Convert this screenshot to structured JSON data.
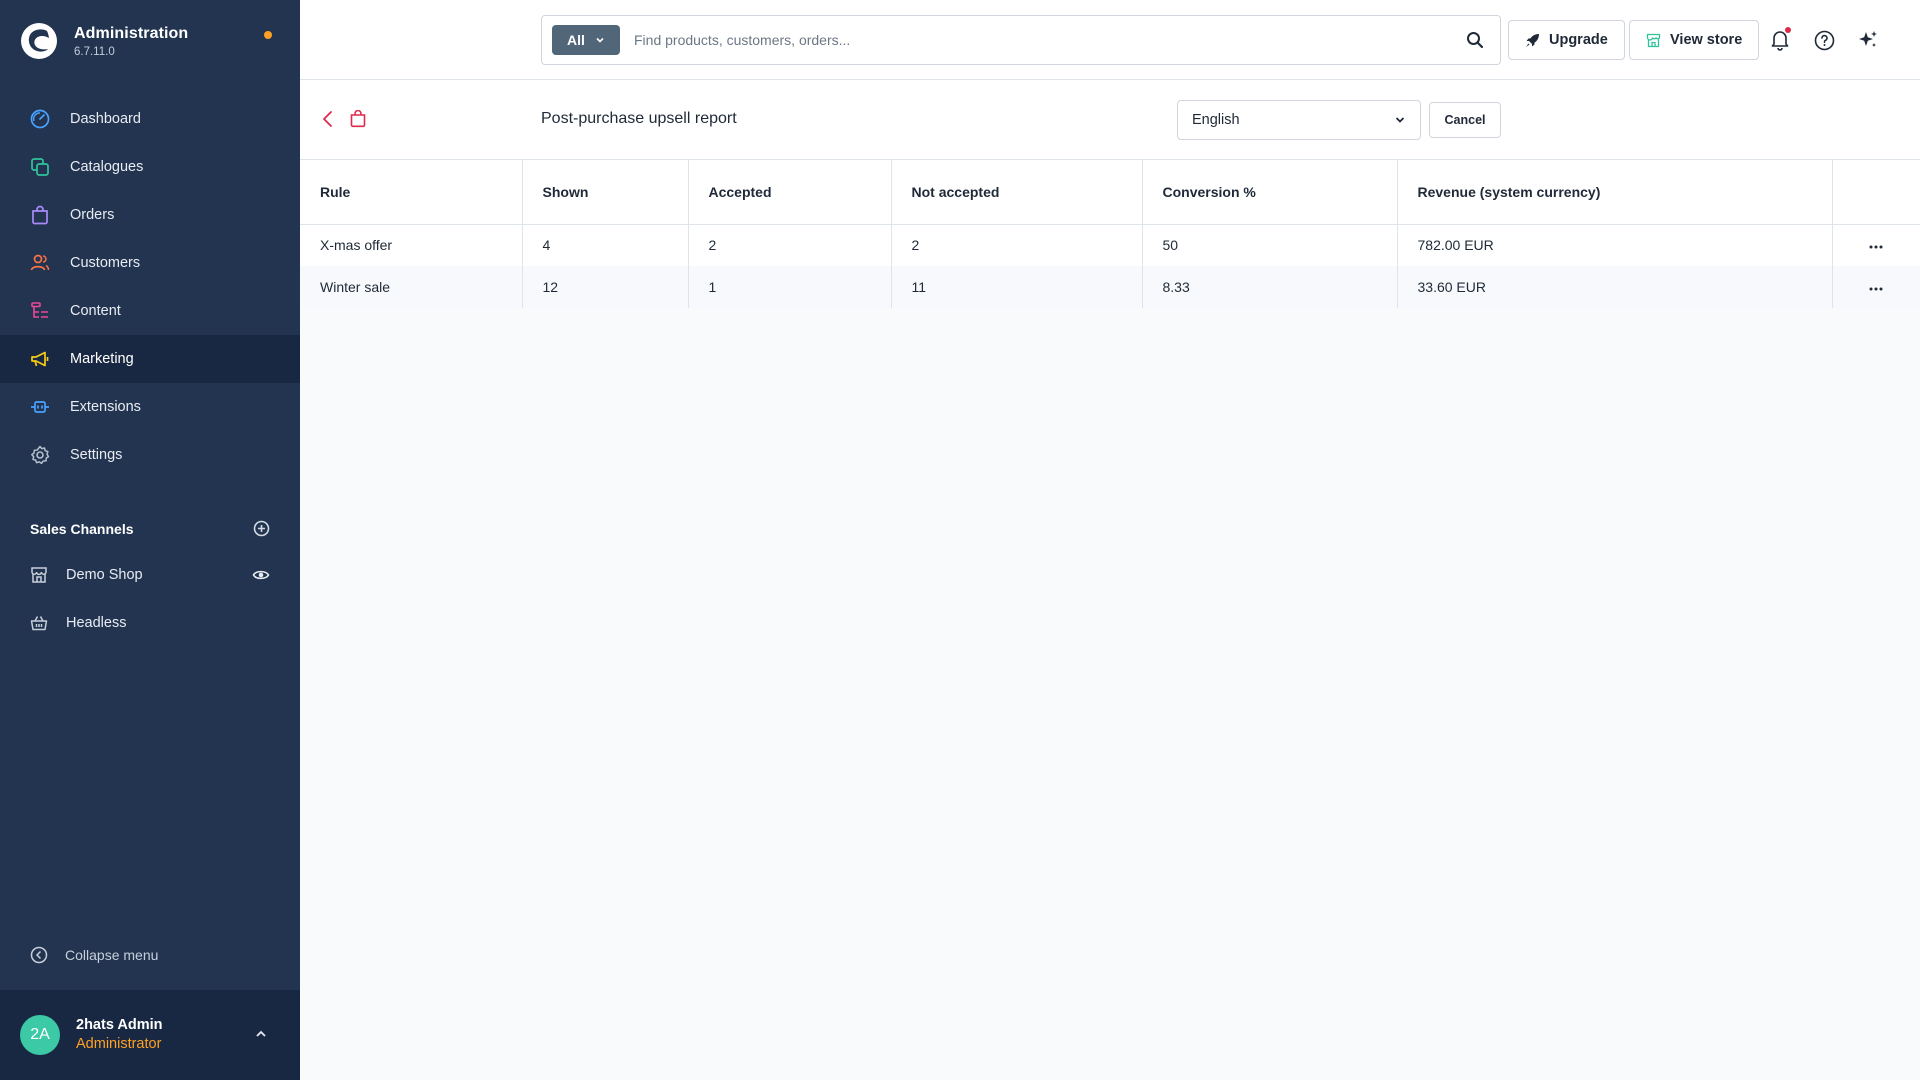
{
  "app": {
    "title": "Administration",
    "version": "6.7.11.0"
  },
  "sidebar": {
    "items": [
      {
        "label": "Dashboard",
        "icon": "dashboard-icon"
      },
      {
        "label": "Catalogues",
        "icon": "catalogues-icon"
      },
      {
        "label": "Orders",
        "icon": "orders-icon"
      },
      {
        "label": "Customers",
        "icon": "customers-icon"
      },
      {
        "label": "Content",
        "icon": "content-icon"
      },
      {
        "label": "Marketing",
        "icon": "megaphone-icon",
        "active": true
      },
      {
        "label": "Extensions",
        "icon": "plug-icon"
      },
      {
        "label": "Settings",
        "icon": "gear-icon"
      }
    ],
    "sales_channels_title": "Sales Channels",
    "channels": [
      {
        "label": "Demo Shop",
        "icon": "storefront-icon"
      },
      {
        "label": "Headless",
        "icon": "basket-icon"
      }
    ],
    "collapse_label": "Collapse menu"
  },
  "user": {
    "initials": "2A",
    "name": "2hats Admin",
    "role": "Administrator"
  },
  "topbar": {
    "search_type": "All",
    "search_placeholder": "Find products, customers, orders...",
    "upgrade_label": "Upgrade",
    "view_store_label": "View store"
  },
  "page": {
    "title": "Post-purchase upsell report",
    "language": "English",
    "cancel_label": "Cancel"
  },
  "table": {
    "columns": [
      "Rule",
      "Shown",
      "Accepted",
      "Not accepted",
      "Conversion %",
      "Revenue (system currency)"
    ],
    "rows": [
      {
        "rule": "X-mas offer",
        "shown": "4",
        "accepted": "2",
        "not_accepted": "2",
        "conversion": "50",
        "revenue": "782.00 EUR"
      },
      {
        "rule": "Winter sale",
        "shown": "12",
        "accepted": "1",
        "not_accepted": "11",
        "conversion": "8.33",
        "revenue": "33.60 EUR"
      }
    ],
    "row_action_glyph": "···"
  },
  "colors": {
    "sidebar_bg": "#233450",
    "sidebar_active": "#192842",
    "accent_orange": "#ffa122",
    "avatar_green": "#3cc9a6",
    "back_red": "#de294c"
  }
}
